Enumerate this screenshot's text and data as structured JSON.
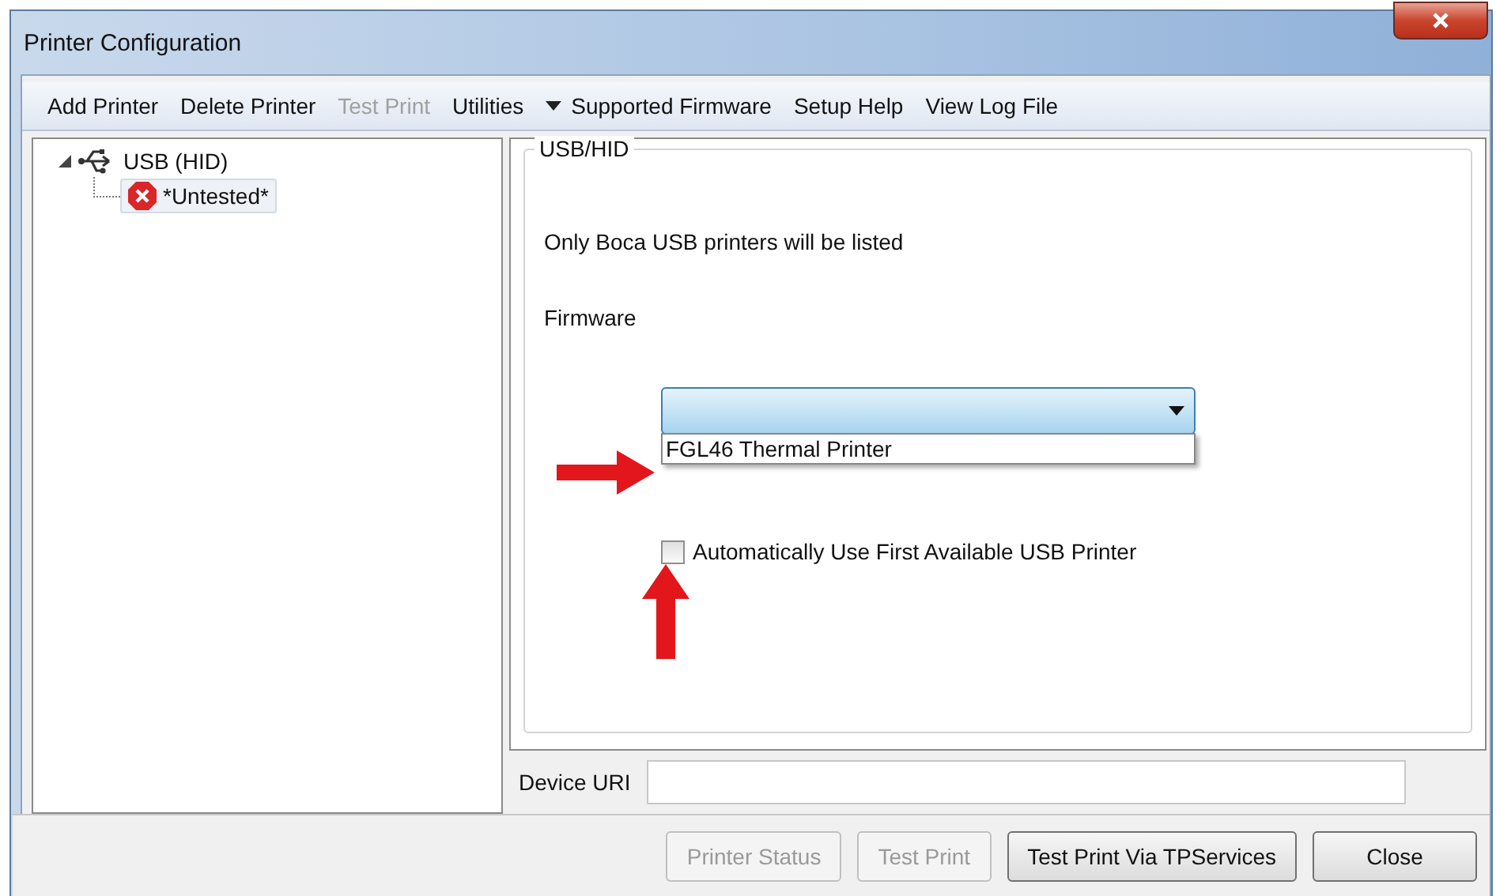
{
  "window": {
    "title": "Printer Configuration"
  },
  "toolbar": [
    {
      "label": "Add Printer",
      "disabled": false,
      "kind": "plain"
    },
    {
      "label": "Delete Printer",
      "disabled": false,
      "kind": "plain"
    },
    {
      "label": "Test Print",
      "disabled": true,
      "kind": "plain"
    },
    {
      "label": "Utilities",
      "disabled": false,
      "kind": "plain"
    },
    {
      "label": "Supported Firmware",
      "disabled": false,
      "kind": "dropdown"
    },
    {
      "label": "Setup Help",
      "disabled": false,
      "kind": "plain"
    },
    {
      "label": "View Log File",
      "disabled": false,
      "kind": "plain"
    }
  ],
  "tree": [
    {
      "label": "USB (HID)",
      "expanded": true,
      "children": [
        {
          "label": "*Untested*",
          "error": true,
          "selected": true
        }
      ]
    }
  ],
  "group": {
    "title": "USB/HID",
    "note": "Only Boca USB printers will be listed",
    "firmware_label": "Firmware",
    "firmware_select": {
      "expanded": true,
      "options": [
        {
          "label": "FGL46 Thermal Printer",
          "selected": false
        }
      ]
    },
    "auto_checkbox": {
      "label": "Automatically Use First Available USB Printer",
      "checked": false
    }
  },
  "device_uri": {
    "label": "Device URI"
  },
  "buttons": [
    {
      "label": "Printer Status",
      "disabled": true
    },
    {
      "label": "Test Print",
      "disabled": true
    },
    {
      "label": "Test Print Via TPServices",
      "disabled": false
    },
    {
      "label": "Close",
      "disabled": false
    }
  ]
}
